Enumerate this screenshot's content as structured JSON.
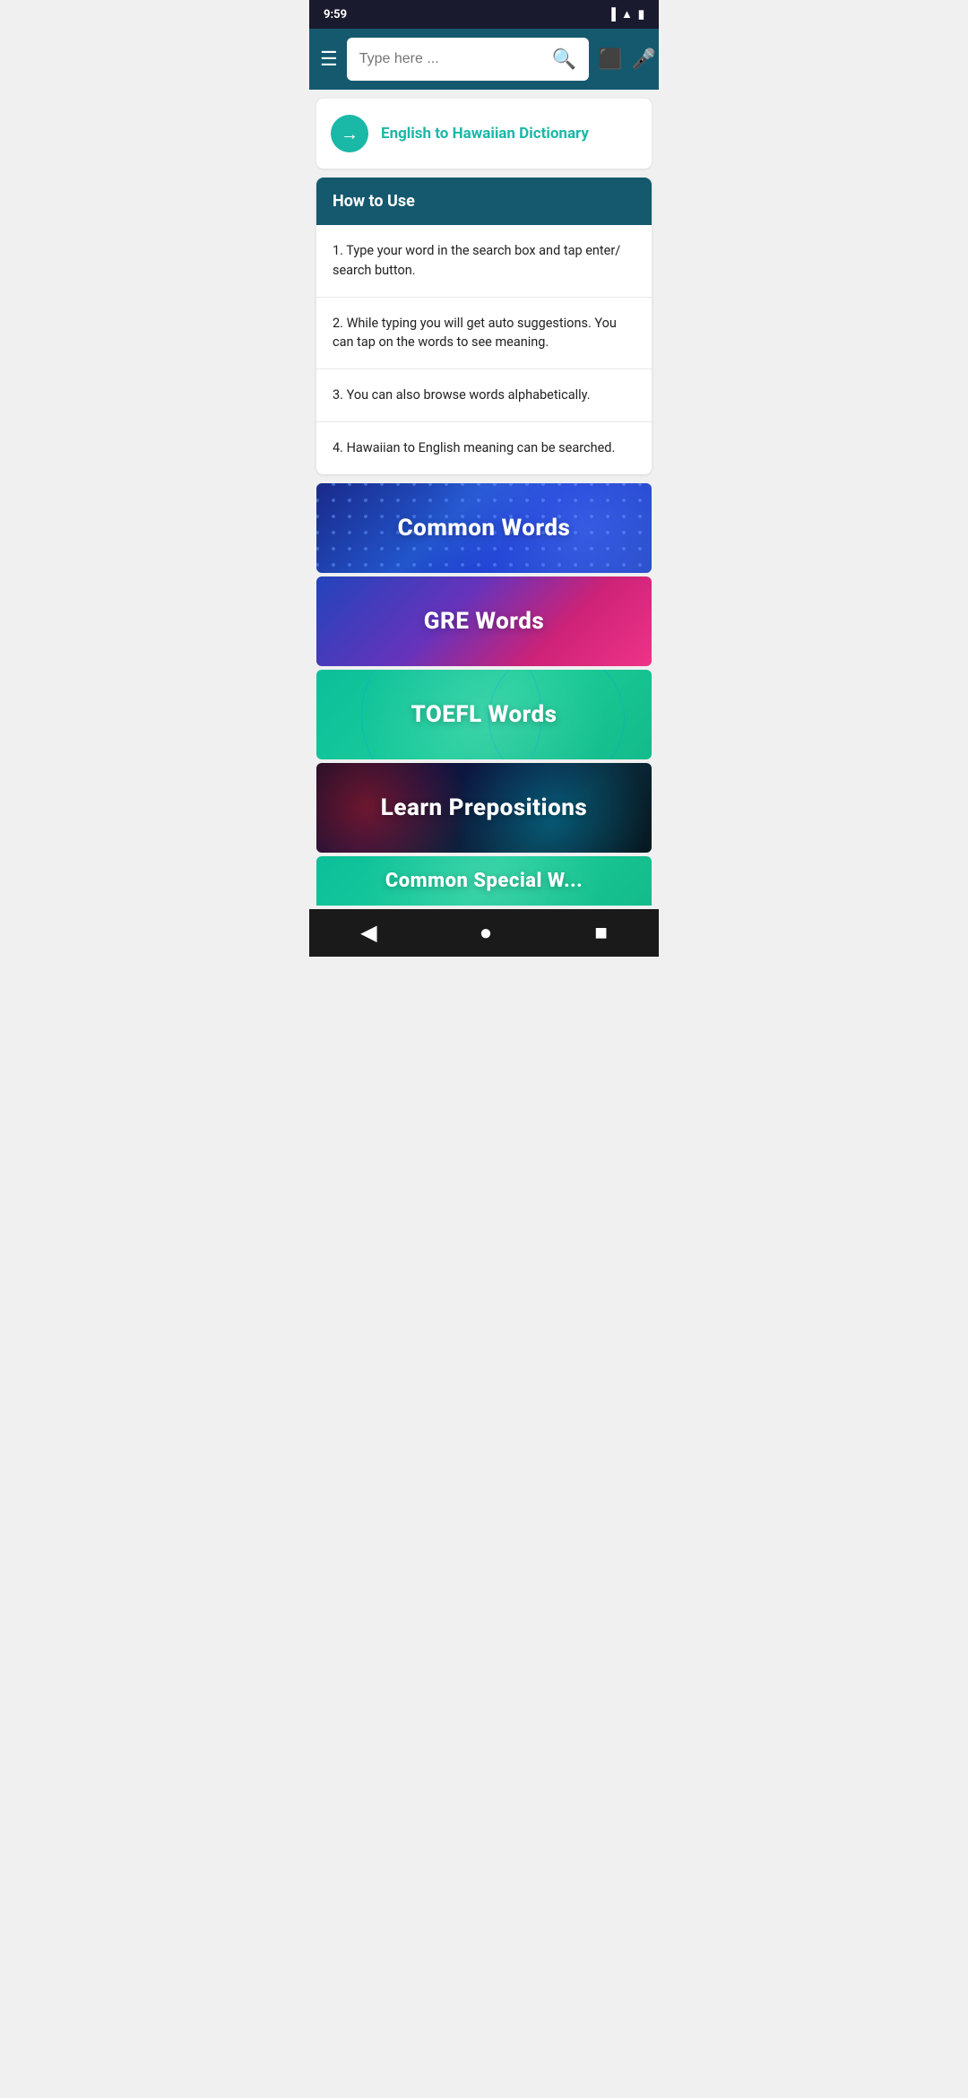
{
  "statusBar": {
    "time": "9:59",
    "icons": [
      "sim",
      "wifi",
      "battery"
    ]
  },
  "topBar": {
    "menuIcon": "☰",
    "searchPlaceholder": "Type here ...",
    "searchIconLabel": "🔍",
    "cameraIconLabel": "⬛",
    "micIconLabel": "🎤"
  },
  "dictionaryTitle": {
    "arrowLabel": "→",
    "title": "English to Hawaiian Dictionary"
  },
  "howToUse": {
    "header": "How to Use",
    "items": [
      "1. Type your word in the search box and tap enter/ search button.",
      "2. While typing you will get auto suggestions. You can tap on the words to see meaning.",
      "3. You can also browse words alphabetically.",
      "4. Hawaiian to English meaning can be searched."
    ]
  },
  "banners": [
    {
      "label": "Common Words",
      "type": "common"
    },
    {
      "label": "GRE Words",
      "type": "gre"
    },
    {
      "label": "TOEFL Words",
      "type": "toefl"
    },
    {
      "label": "Learn Prepositions",
      "type": "prepositions"
    },
    {
      "label": "Common Special W...",
      "type": "partial"
    }
  ],
  "bottomNav": {
    "back": "◀",
    "home": "●",
    "recent": "■"
  }
}
